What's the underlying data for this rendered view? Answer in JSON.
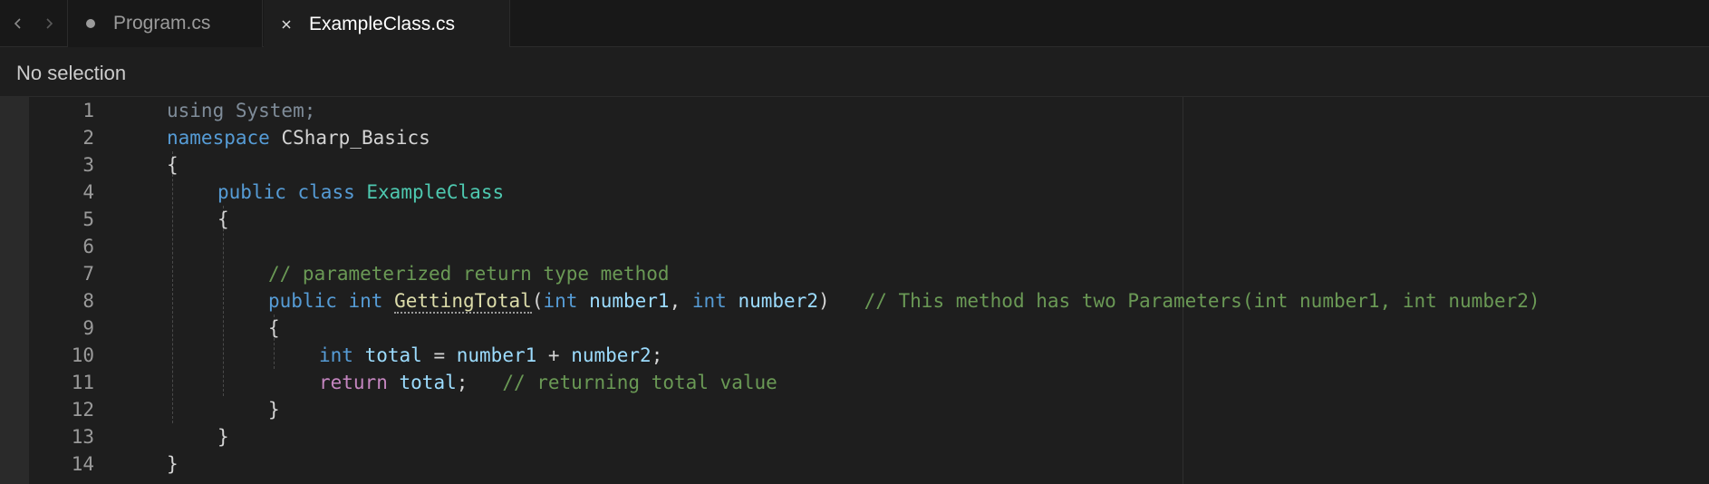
{
  "tabs": [
    {
      "label": "Program.cs",
      "state": "modified",
      "icon": "dot-icon"
    },
    {
      "label": "ExampleClass.cs",
      "state": "active",
      "icon": "close-icon"
    }
  ],
  "breadcrumb": {
    "text": "No selection"
  },
  "editor": {
    "lines": [
      {
        "n": "1",
        "t": [
          "using",
          " System;"
        ]
      },
      {
        "n": "2",
        "t": [
          "namespace",
          " CSharp_Basics"
        ]
      },
      {
        "n": "3",
        "t": [
          "{"
        ]
      },
      {
        "n": "4",
        "t": [
          "public",
          " ",
          "class",
          " ",
          "ExampleClass"
        ]
      },
      {
        "n": "5",
        "t": [
          "{"
        ]
      },
      {
        "n": "6",
        "t": []
      },
      {
        "n": "7",
        "t": [
          "// parameterized return type method"
        ]
      },
      {
        "n": "8",
        "t": [
          "public",
          " ",
          "int",
          " ",
          "GettingTotal",
          "(",
          "int",
          " ",
          "number1",
          ", ",
          "int",
          " ",
          "number2",
          ")",
          "   ",
          "// This method has two Parameters(int number1, int number2)"
        ]
      },
      {
        "n": "9",
        "t": [
          "{"
        ]
      },
      {
        "n": "10",
        "t": [
          "int",
          " ",
          "total",
          " = ",
          "number1",
          " + ",
          "number2",
          ";"
        ]
      },
      {
        "n": "11",
        "t": [
          "return",
          " ",
          "total",
          ";",
          "   ",
          "// returning total value"
        ]
      },
      {
        "n": "12",
        "t": [
          "}"
        ]
      },
      {
        "n": "13",
        "t": [
          "}"
        ]
      },
      {
        "n": "14",
        "t": [
          "}"
        ]
      }
    ]
  },
  "colors": {
    "background": "#1e1e1e",
    "keyword": "#569cd6",
    "control_keyword": "#c586c0",
    "type": "#4ec9b0",
    "function": "#dcdcaa",
    "variable": "#9cdcfe",
    "comment": "#6a9955",
    "line_number": "#9a9a9a"
  }
}
